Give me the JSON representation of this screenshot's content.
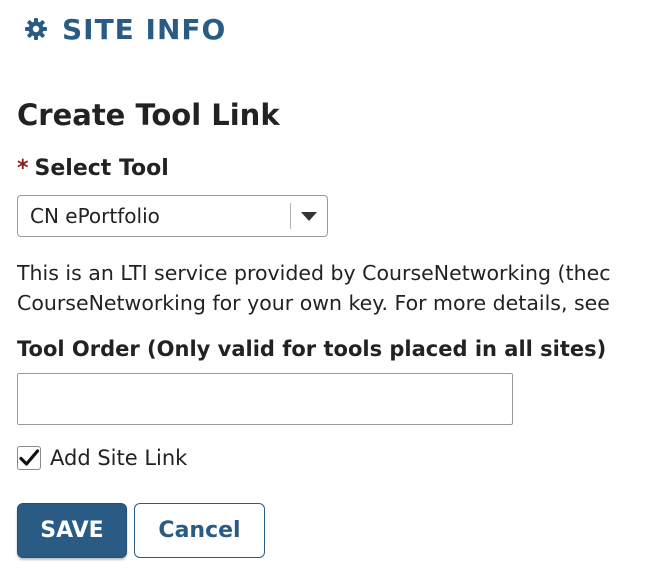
{
  "header": {
    "icon": "gear-icon",
    "title": "SITE INFO"
  },
  "form": {
    "heading": "Create Tool Link",
    "select_tool": {
      "required_marker": "*",
      "label": "Select Tool",
      "selected_value": "CN ePortfolio"
    },
    "description_line1": "This is an LTI service provided by CourseNetworking (thec",
    "description_line2": "CourseNetworking for your own key. For more details, see",
    "tool_order": {
      "label": "Tool Order (Only valid for tools placed in all sites)",
      "value": ""
    },
    "add_site_link": {
      "label": "Add Site Link",
      "checked": true
    },
    "buttons": {
      "save": "SAVE",
      "cancel": "Cancel"
    }
  },
  "colors": {
    "brand": "#2a5b84",
    "required": "#8c1b1b"
  }
}
